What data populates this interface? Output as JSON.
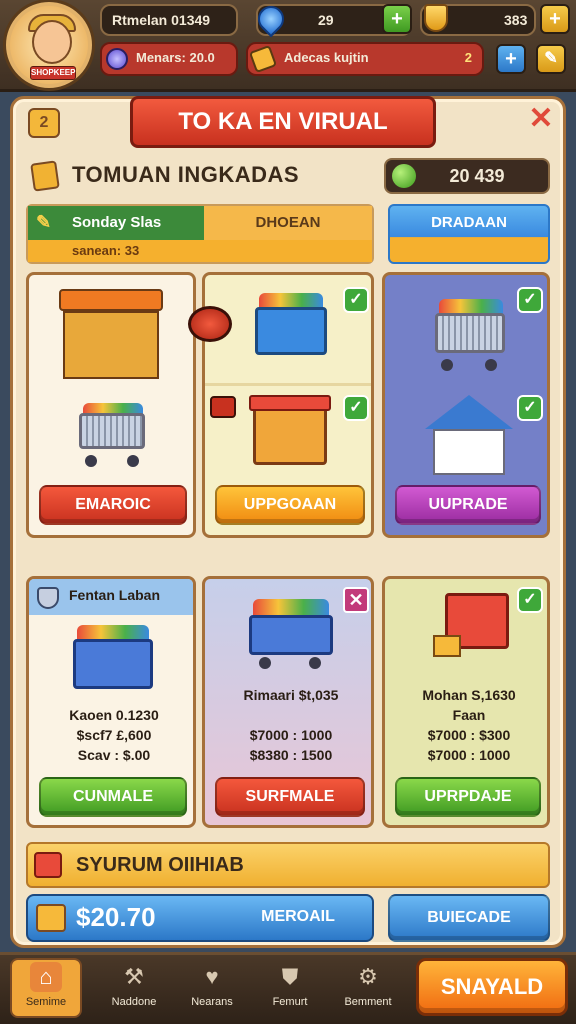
{
  "player": {
    "badge": "SHOPKEEP",
    "name": "Rtmelan 01349"
  },
  "resources": {
    "gems": "29",
    "coins": "383",
    "plus": "+",
    "bonus": "Menars: 20.0",
    "bonus2": "Adecas kujtin",
    "bonus2_count": "2"
  },
  "header": {
    "title": "TO KA EN VIRUAL",
    "badge": "2",
    "close": "✕"
  },
  "section": {
    "title": "TOMUAN INGKADAS",
    "counter": "20 439"
  },
  "progress": {
    "left_label": "Sonday Slas",
    "right_label": "DHOEAN",
    "sub_label": "sanean: 33",
    "side_button": "DRADAAN",
    "fill": 0.5
  },
  "cards_top": [
    {
      "button": "EMAROIC"
    },
    {
      "button": "UPPGOAAN"
    },
    {
      "button": "UUPRADE"
    }
  ],
  "cards_bottom": [
    {
      "title": "Fentan Laban",
      "stat1": "Kaoen 0.1230",
      "stat2": "$scf7 £,600",
      "stat3": "Scav : $.00",
      "button": "CUNMALE"
    },
    {
      "title": "Rimaari $t,035",
      "stat1": "$7000 : 1000",
      "stat2": "$8380 : 1500",
      "button": "SURFMALE"
    },
    {
      "title": "Mohan S,1630",
      "stat1": "Faan",
      "stat2": "$7000 : $300",
      "stat3": "$7000 : 1000",
      "button": "UPRPDAJE"
    }
  ],
  "banner": {
    "label": "SYURUM OIIHIAB"
  },
  "money": {
    "amount": "$20.70",
    "label": "MEROAIL"
  },
  "upgrade_button": "BUIECADE",
  "nav": [
    {
      "label": "Semime",
      "icon": "home-icon"
    },
    {
      "label": "Naddone",
      "icon": "hammer-icon"
    },
    {
      "label": "Nearans",
      "icon": "heart-icon"
    },
    {
      "label": "Femurt",
      "icon": "shield-icon"
    },
    {
      "label": "Bemment",
      "icon": "gear-icon"
    }
  ],
  "save_button": "SNAYALD"
}
